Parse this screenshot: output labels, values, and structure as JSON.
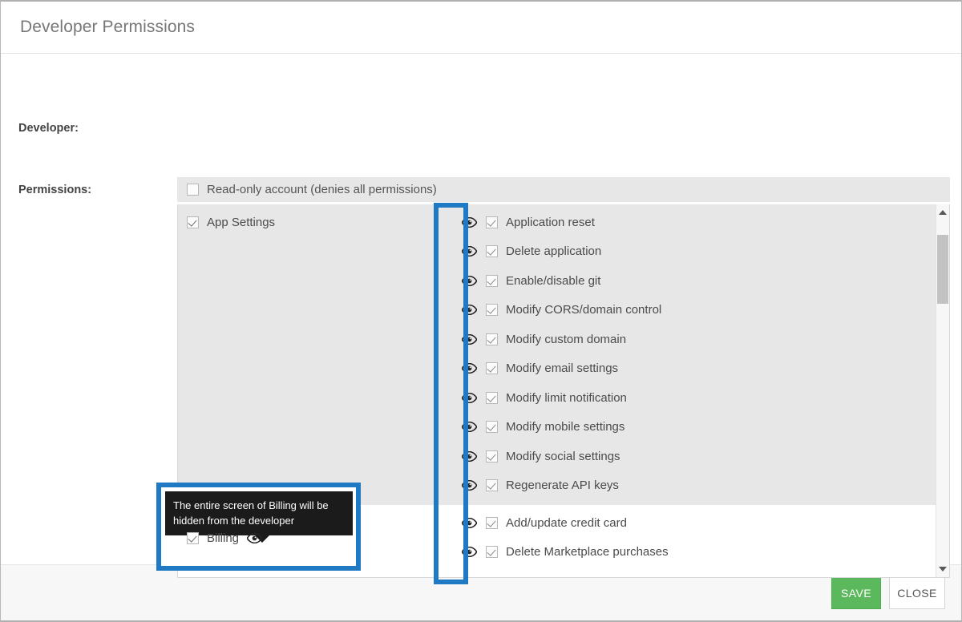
{
  "dialog": {
    "title": "Developer Permissions",
    "labels": {
      "developer": "Developer:",
      "permissions": "Permissions:"
    }
  },
  "readonly": {
    "label": "Read-only account (denies all permissions)",
    "checked": false
  },
  "sections": [
    {
      "name": "app-settings",
      "label": "App Settings",
      "checked": true,
      "shaded": true,
      "items": [
        {
          "label": "Application reset",
          "checked": true,
          "eye": true
        },
        {
          "label": "Delete application",
          "checked": true,
          "eye": true
        },
        {
          "label": "Enable/disable git",
          "checked": true,
          "eye": true
        },
        {
          "label": "Modify CORS/domain control",
          "checked": true,
          "eye": true
        },
        {
          "label": "Modify custom domain",
          "checked": true,
          "eye": true
        },
        {
          "label": "Modify email settings",
          "checked": true,
          "eye": true
        },
        {
          "label": "Modify limit notification",
          "checked": true,
          "eye": true
        },
        {
          "label": "Modify mobile settings",
          "checked": true,
          "eye": true
        },
        {
          "label": "Modify social settings",
          "checked": true,
          "eye": true
        },
        {
          "label": "Regenerate API keys",
          "checked": true,
          "eye": true
        }
      ]
    },
    {
      "name": "billing",
      "label": "Billing",
      "checked": true,
      "shaded": false,
      "items": [
        {
          "label": "Add/update credit card",
          "checked": true,
          "eye": true
        },
        {
          "label": "Delete Marketplace purchases",
          "checked": true,
          "eye": true
        }
      ]
    }
  ],
  "tooltip": {
    "text": "The entire screen of Billing will be hidden from the developer"
  },
  "highlights": {
    "color": "#1f79c3",
    "eye_column": "eye-visibility-column",
    "billing_row": "billing-section-row"
  },
  "scrollbar": {
    "up_icon": "triangle-up-icon",
    "down_icon": "triangle-down-icon"
  },
  "footer": {
    "save_label": "SAVE",
    "close_label": "CLOSE",
    "save_color": "#5cb85c"
  },
  "icons": {
    "eye": "eye-icon",
    "check": "checkmark-icon"
  }
}
